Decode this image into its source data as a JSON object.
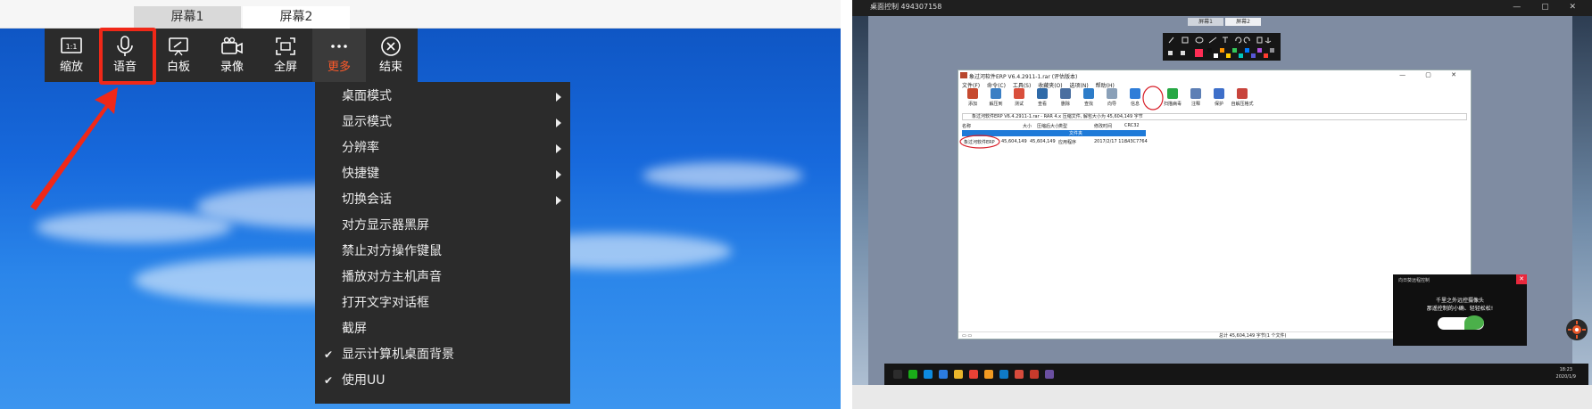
{
  "left": {
    "tabs": [
      "屏幕1",
      "屏幕2"
    ],
    "toolbar": {
      "items": [
        {
          "id": "zoom",
          "label": "缩放",
          "icon": "zoom-1to1-icon",
          "icon_text": "1:1"
        },
        {
          "id": "voice",
          "label": "语音",
          "icon": "microphone-icon"
        },
        {
          "id": "whiteboard",
          "label": "白板",
          "icon": "whiteboard-icon"
        },
        {
          "id": "record",
          "label": "录像",
          "icon": "camera-icon"
        },
        {
          "id": "fullscreen",
          "label": "全屏",
          "icon": "fullscreen-icon"
        },
        {
          "id": "more",
          "label": "更多",
          "icon": "more-dots-icon",
          "active": true
        },
        {
          "id": "end",
          "label": "结束",
          "icon": "close-circle-icon"
        }
      ],
      "highlight_color": "#f02818",
      "active_color": "#ff5a2a"
    },
    "more_menu": [
      {
        "label": "桌面模式",
        "submenu": true,
        "checked": false
      },
      {
        "label": "显示模式",
        "submenu": true,
        "checked": false
      },
      {
        "label": "分辨率",
        "submenu": true,
        "checked": false
      },
      {
        "label": "快捷键",
        "submenu": true,
        "checked": false
      },
      {
        "label": "切换会话",
        "submenu": true,
        "checked": false
      },
      {
        "label": "对方显示器黑屏",
        "submenu": false,
        "checked": false
      },
      {
        "label": "禁止对方操作键鼠",
        "submenu": false,
        "checked": false
      },
      {
        "label": "播放对方主机声音",
        "submenu": false,
        "checked": false
      },
      {
        "label": "打开文字对话框",
        "submenu": false,
        "checked": false
      },
      {
        "label": "截屏",
        "submenu": false,
        "checked": false
      },
      {
        "label": "显示计算机桌面背景",
        "submenu": false,
        "checked": true
      },
      {
        "label": "使用UU",
        "submenu": false,
        "checked": true
      }
    ]
  },
  "right": {
    "window_title": "桌面控制 494307158",
    "window_buttons": "— ▢ ✕",
    "tabs": [
      "屏幕1",
      "屏幕2"
    ],
    "annotation_colors": [
      "#ff2d55",
      "#111111",
      "#ffffff",
      "#ff9500",
      "#ffcc00",
      "#34c759",
      "#00c7be",
      "#007aff",
      "#5856d6",
      "#af52de",
      "#ff3b30",
      "#8e8e93"
    ],
    "winrar": {
      "title": "象过河软件ERP V6.4.2911-1.rar (评估版本)",
      "menu": "文件(F) 命令(C) 工具(S) 收藏夹(O) 选项(N) 帮助(H)",
      "tools": [
        {
          "label": "添加",
          "color": "#c64a2f"
        },
        {
          "label": "解压到",
          "color": "#3b7fc4"
        },
        {
          "label": "测试",
          "color": "#d94f3c"
        },
        {
          "label": "查看",
          "color": "#2f6aa8"
        },
        {
          "label": "删除",
          "color": "#4a6fa0"
        },
        {
          "label": "查找",
          "color": "#2d7cc8"
        },
        {
          "label": "向导",
          "color": "#8aa0b8"
        },
        {
          "label": "信息",
          "color": "#2f7dd8"
        },
        {
          "label": "扫描病毒",
          "color": "#27a845"
        },
        {
          "label": "注释",
          "color": "#5d7fb5"
        },
        {
          "label": "保护",
          "color": "#3e6fc9"
        },
        {
          "label": "自解压格式",
          "color": "#c8443c"
        }
      ],
      "path": "象过河软件ERP V6.4.2911-1.rar - RAR 4.x 压缩文件, 解包大小为 45,604,149 字节",
      "columns": [
        "名称",
        "大小",
        "压缩后大小",
        "类型",
        "修改时间",
        "CRC32"
      ],
      "folder_row": "文件夹",
      "row": {
        "name": "象过河软件ERP",
        "size": "45,604,149",
        "packed": "45,604,149",
        "type": "应用程序",
        "modified": "2017/2/17 11:...",
        "crc": "843C7764"
      },
      "status_left": "▭ ▭",
      "status_right": "总计 45,604,149 字节(1 个文件)"
    },
    "notification": {
      "title": "向日葵远程控制",
      "line1": "千里之外远控摄像头",
      "line2": "那遥控制的小确、轻轻松松!",
      "close": "✕"
    },
    "taskbar": {
      "time": "18:23",
      "date": "2020/1/9",
      "icon_colors": [
        "#2c2c2c",
        "#1aad19",
        "#0d8ae0",
        "#2b7be0",
        "#e9b52b",
        "#e94235",
        "#f29b22",
        "#0f7ac6",
        "#d84b3c",
        "#c93a2c",
        "#6a4fa0"
      ]
    }
  }
}
